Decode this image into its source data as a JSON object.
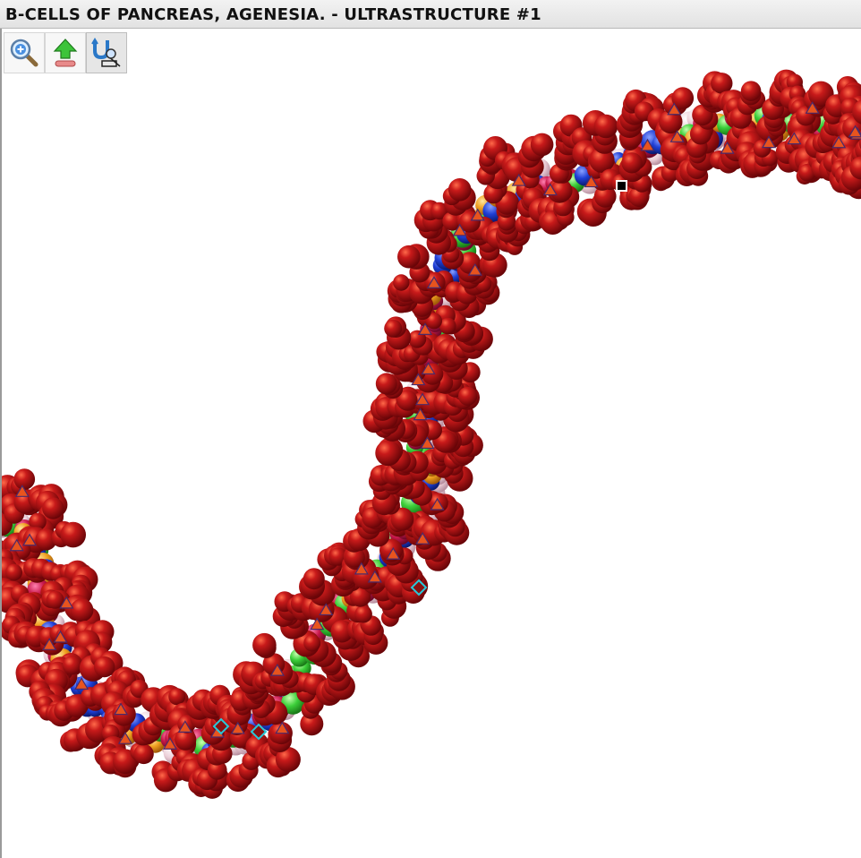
{
  "window": {
    "title": "B-CELLS OF PANCREAS, AGENESIA. - ULTRASTRUCTURE #1"
  },
  "toolbar": {
    "buttons": [
      {
        "name": "zoom-in",
        "icon": "magnifier-plus-icon"
      },
      {
        "name": "upload",
        "icon": "green-up-arrow-icon"
      },
      {
        "name": "view-toggle",
        "icon": "u-magnifier-icon",
        "active": true
      }
    ]
  },
  "viewer": {
    "subject": "dna-double-helix-molecular-model",
    "colors": {
      "backbone": "#a8141a",
      "base_green": "#3ccf3a",
      "base_blue": "#1f3fd6",
      "base_orange": "#f0a020",
      "base_white": "#f0dce4",
      "marker_triangle": "#e8541e",
      "marker_diamond": "#28c8d8"
    }
  }
}
